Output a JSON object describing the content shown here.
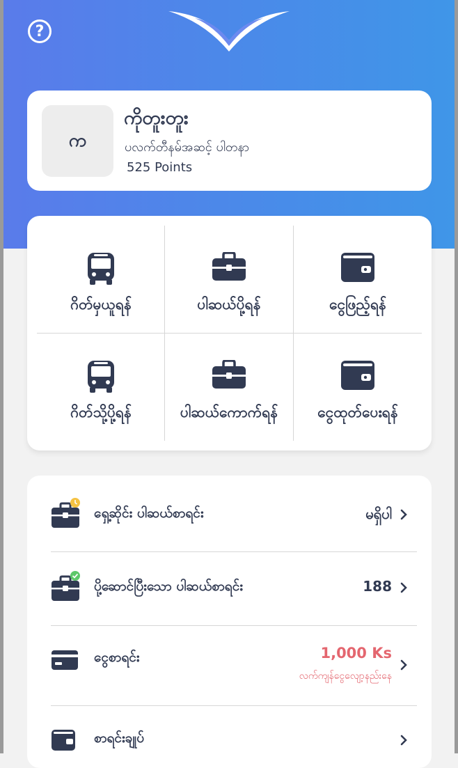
{
  "header": {
    "help_icon": "question-circle-icon",
    "help_symbol": "?",
    "logo_icon": "wing-logo-icon"
  },
  "profile": {
    "avatar_text": "က",
    "name": "ကိုတူးတူး",
    "subtitle": "ပလက်တီနမ်အဆင့် ပါတနာ",
    "points": "525 Points"
  },
  "actions": [
    {
      "label": "ဂိတ်မှယူရန်",
      "icon": "bus-icon"
    },
    {
      "label": "ပါဆယ်ပို့ရန်",
      "icon": "briefcase-icon"
    },
    {
      "label": "ငွေဖြည့်ရန်",
      "icon": "wallet-icon"
    },
    {
      "label": "ဂိတ်သို့ပို့ရန်",
      "icon": "bus-icon"
    },
    {
      "label": "ပါဆယ်ကောက်ရန်",
      "icon": "briefcase-icon"
    },
    {
      "label": "ငွေထုတ်ပေးရန်",
      "icon": "wallet-icon"
    }
  ],
  "list": {
    "pending": {
      "label": "ရှေ့ဆိုင်း ပါဆယ်စာရင်း",
      "value": "မရှိပါ",
      "icon": "briefcase-pending-icon",
      "badge_color": "#f5c242"
    },
    "delivered": {
      "label": "ပို့ဆောင်ပြီးသော ပါဆယ်စာရင်း",
      "value": "188",
      "icon": "briefcase-done-icon",
      "badge_color": "#5dc86a"
    },
    "money": {
      "label": "ငွေစာရင်း",
      "amount": "1,000 Ks",
      "note": "လက်ကျန်ငွေလျော့နည်းနေ",
      "icon": "card-icon"
    },
    "summary": {
      "label": "စာရင်းချုပ်",
      "icon": "wallet-icon"
    }
  },
  "colors": {
    "accent_gradient_start": "#5a7bea",
    "accent_gradient_end": "#3f96e8",
    "icon_navy": "#313a52",
    "warning": "#e4666f"
  }
}
